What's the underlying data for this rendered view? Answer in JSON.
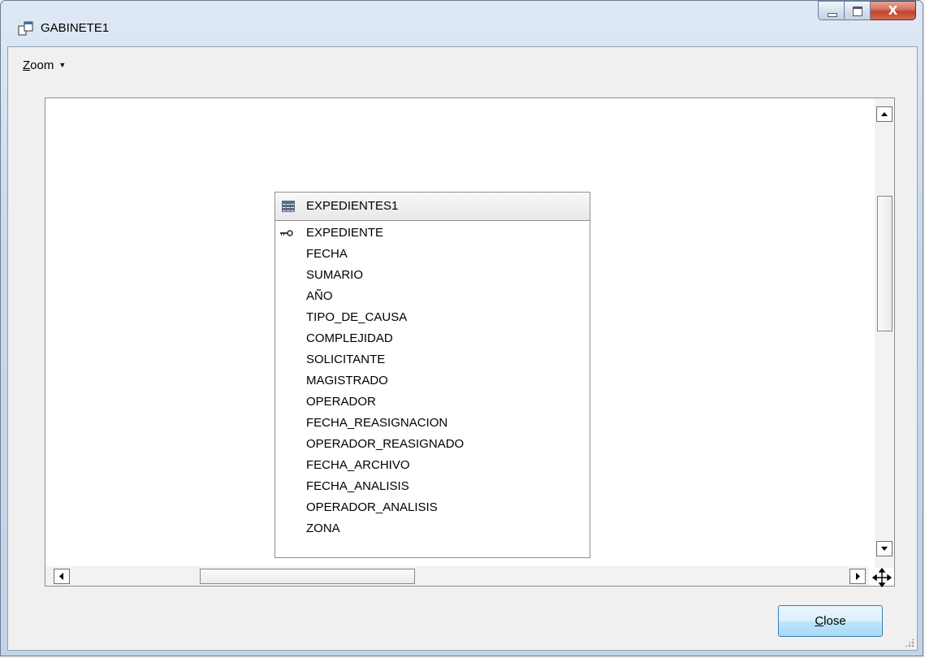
{
  "window": {
    "title": "GABINETE1"
  },
  "caption": {
    "close_glyph": "X"
  },
  "menu": {
    "zoom_label_accel": "Z",
    "zoom_label_rest": "oom"
  },
  "table": {
    "name": "EXPEDIENTES1",
    "fields": [
      "EXPEDIENTE",
      "FECHA",
      "SUMARIO",
      "AÑO",
      "TIPO_DE_CAUSA",
      "COMPLEJIDAD",
      "SOLICITANTE",
      "MAGISTRADO",
      "OPERADOR",
      "FECHA_REASIGNACION",
      "OPERADOR_REASIGNADO",
      "FECHA_ARCHIVO",
      "FECHA_ANALISIS",
      "OPERADOR_ANALISIS",
      "ZONA"
    ],
    "primary_key": "EXPEDIENTE"
  },
  "buttons": {
    "close_accel": "C",
    "close_rest": "lose"
  }
}
